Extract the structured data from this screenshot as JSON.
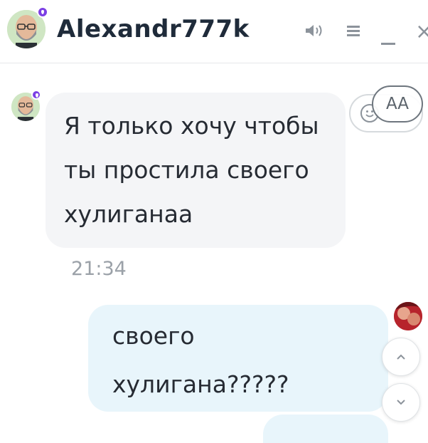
{
  "header": {
    "title": "Alexandr777k",
    "avatar_icon": "bald-bearded-man-avatar-icon",
    "status_icon": "purple-drop-status-icon",
    "controls": [
      "sound-icon",
      "menu-icon",
      "minimize-icon",
      "close-icon"
    ],
    "close_glyph": "×"
  },
  "messages": [
    {
      "direction": "incoming",
      "text": "Я только хочу чтобы ты простила своего хулиганаа",
      "time": "21:34"
    },
    {
      "direction": "outgoing",
      "text": "своего хулигана?????"
    }
  ],
  "reaction": {
    "aa_label": "AA",
    "icon": "smiley-icon"
  },
  "scroll_controls": [
    "scroll-up-button",
    "scroll-down-button"
  ],
  "colors": {
    "incoming_bubble": "#f4f5f7",
    "outgoing_bubble": "#e8f5fb",
    "status_purple": "#7b3fe4",
    "text": "#262b33",
    "muted": "#9ba1a8"
  }
}
